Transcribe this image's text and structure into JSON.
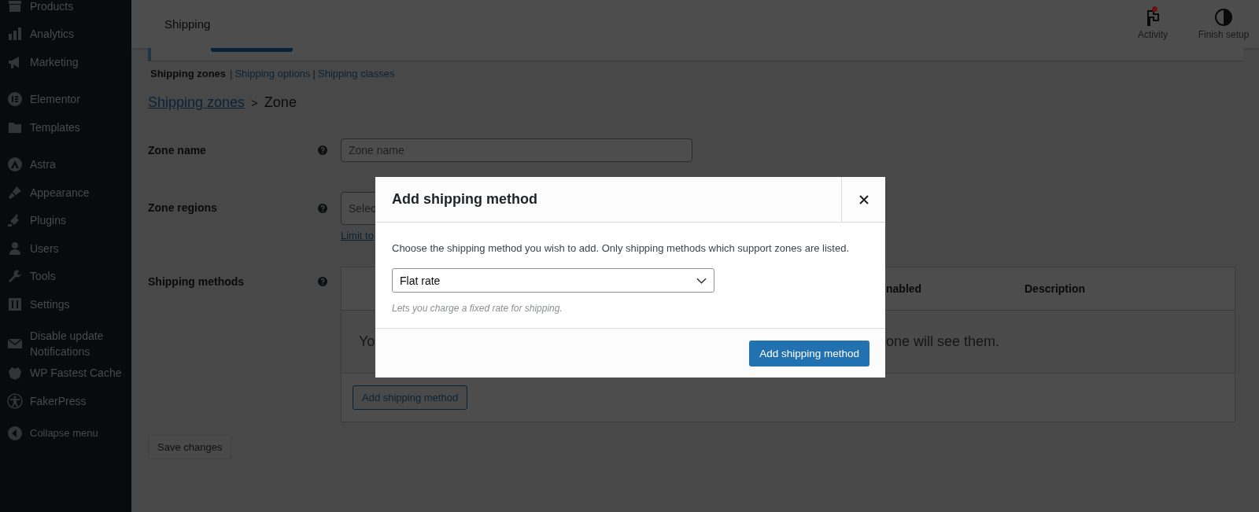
{
  "sidebar": {
    "groups": [
      [
        {
          "label": "Products"
        },
        {
          "label": "Analytics"
        },
        {
          "label": "Marketing"
        }
      ],
      [
        {
          "label": "Elementor"
        },
        {
          "label": "Templates"
        }
      ],
      [
        {
          "label": "Astra"
        },
        {
          "label": "Appearance"
        },
        {
          "label": "Plugins"
        },
        {
          "label": "Users"
        },
        {
          "label": "Tools"
        },
        {
          "label": "Settings"
        }
      ],
      [
        {
          "label": "Disable update Notifications"
        },
        {
          "label": "WP Fastest Cache"
        },
        {
          "label": "FakerPress"
        }
      ]
    ],
    "collapse": "Collapse menu"
  },
  "header": {
    "title": "Shipping",
    "actions": [
      {
        "label": "Activity",
        "notification": true
      },
      {
        "label": "Finish setup",
        "notification": false
      }
    ]
  },
  "subnav": {
    "separator": "|",
    "links": [
      {
        "label": "Shipping zones",
        "selected": true
      },
      {
        "label": "Shipping options",
        "selected": false
      },
      {
        "label": "Shipping classes",
        "selected": false
      }
    ]
  },
  "breadcrumb": {
    "link": "Shipping zones",
    "separator": ">",
    "current": "Zone"
  },
  "form": {
    "zone_name": {
      "label": "Zone name",
      "placeholder": "Zone name"
    },
    "zone_regions": {
      "label": "Zone regions",
      "placeholder": "Selec",
      "link": "Limit to"
    },
    "shipping_methods": {
      "label": "Shipping methods",
      "columns": [
        "nabled",
        "Description"
      ],
      "empty_text_start": "Yo",
      "empty_text_end": "one will see them.",
      "add_button": "Add shipping method"
    }
  },
  "save_button": {
    "label": "Save changes",
    "disabled": true
  },
  "modal": {
    "title": "Add shipping method",
    "description": "Choose the shipping method you wish to add. Only shipping methods which support zones are listed.",
    "select_value": "Flat rate",
    "hint": "Lets you charge a fixed rate for shipping.",
    "submit": "Add shipping method"
  }
}
